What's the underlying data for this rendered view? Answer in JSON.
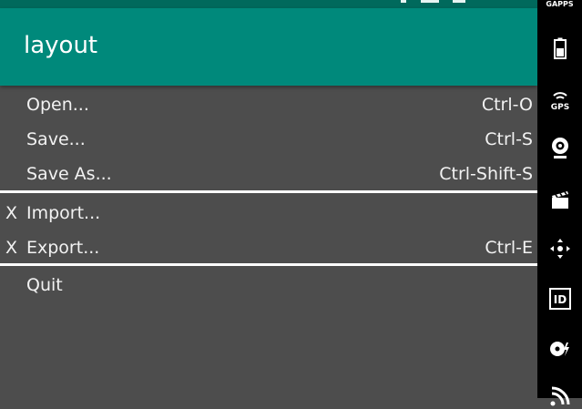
{
  "app": {
    "title": "layout"
  },
  "menu": {
    "items": [
      {
        "check": "",
        "label": "Open...",
        "shortcut": "Ctrl-O"
      },
      {
        "check": "",
        "label": "Save...",
        "shortcut": "Ctrl-S"
      },
      {
        "check": "",
        "label": "Save As...",
        "shortcut": "Ctrl-Shift-S"
      },
      {
        "check": "X",
        "label": "Import...",
        "shortcut": ""
      },
      {
        "check": "X",
        "label": "Export...",
        "shortcut": "Ctrl-E"
      },
      {
        "check": "",
        "label": "Quit",
        "shortcut": ""
      }
    ]
  },
  "side_panel": {
    "gapps_label": "GAPPS",
    "gps_label": "GPS",
    "id_label": "ID",
    "icons": [
      "battery-icon",
      "gps-icon",
      "webcam-icon",
      "clapperboard-icon",
      "dpad-icon",
      "id-icon",
      "disk-icon",
      "rss-icon"
    ]
  },
  "colors": {
    "app_bar": "#00897b",
    "status_bar": "#00695c",
    "menu_background": "#4d4d4d",
    "side_panel": "#000000",
    "separator": "#ffffff"
  }
}
